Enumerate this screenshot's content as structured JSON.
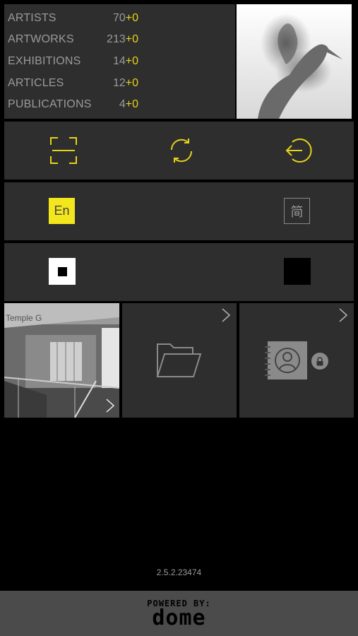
{
  "stats": [
    {
      "label": "ARTISTS",
      "value": "70",
      "delta": "+0"
    },
    {
      "label": "ARTWORKS",
      "value": "213",
      "delta": "+0"
    },
    {
      "label": "EXHIBITIONS",
      "value": "14",
      "delta": "+0"
    },
    {
      "label": "ARTICLES",
      "value": "12",
      "delta": "+0"
    },
    {
      "label": "PUBLICATIONS",
      "value": "4",
      "delta": "+0"
    }
  ],
  "icons": {
    "scan": "scan-frame-icon",
    "refresh": "refresh-icon",
    "logout": "logout-icon",
    "folder": "folder-icon",
    "contacts": "contact-book-icon",
    "lock": "lock-icon",
    "chevron": "chevron-right-icon"
  },
  "language": {
    "english": "En",
    "chinese": "简"
  },
  "colors": {
    "accent": "#f3e61c",
    "panel": "#2e2e2e",
    "background": "#000000",
    "footer": "#4b4b4b"
  },
  "gallery_sign": "Temple G",
  "version": "2.5.2.23474",
  "footer": {
    "powered": "POWERED BY:",
    "brand": "dome"
  }
}
